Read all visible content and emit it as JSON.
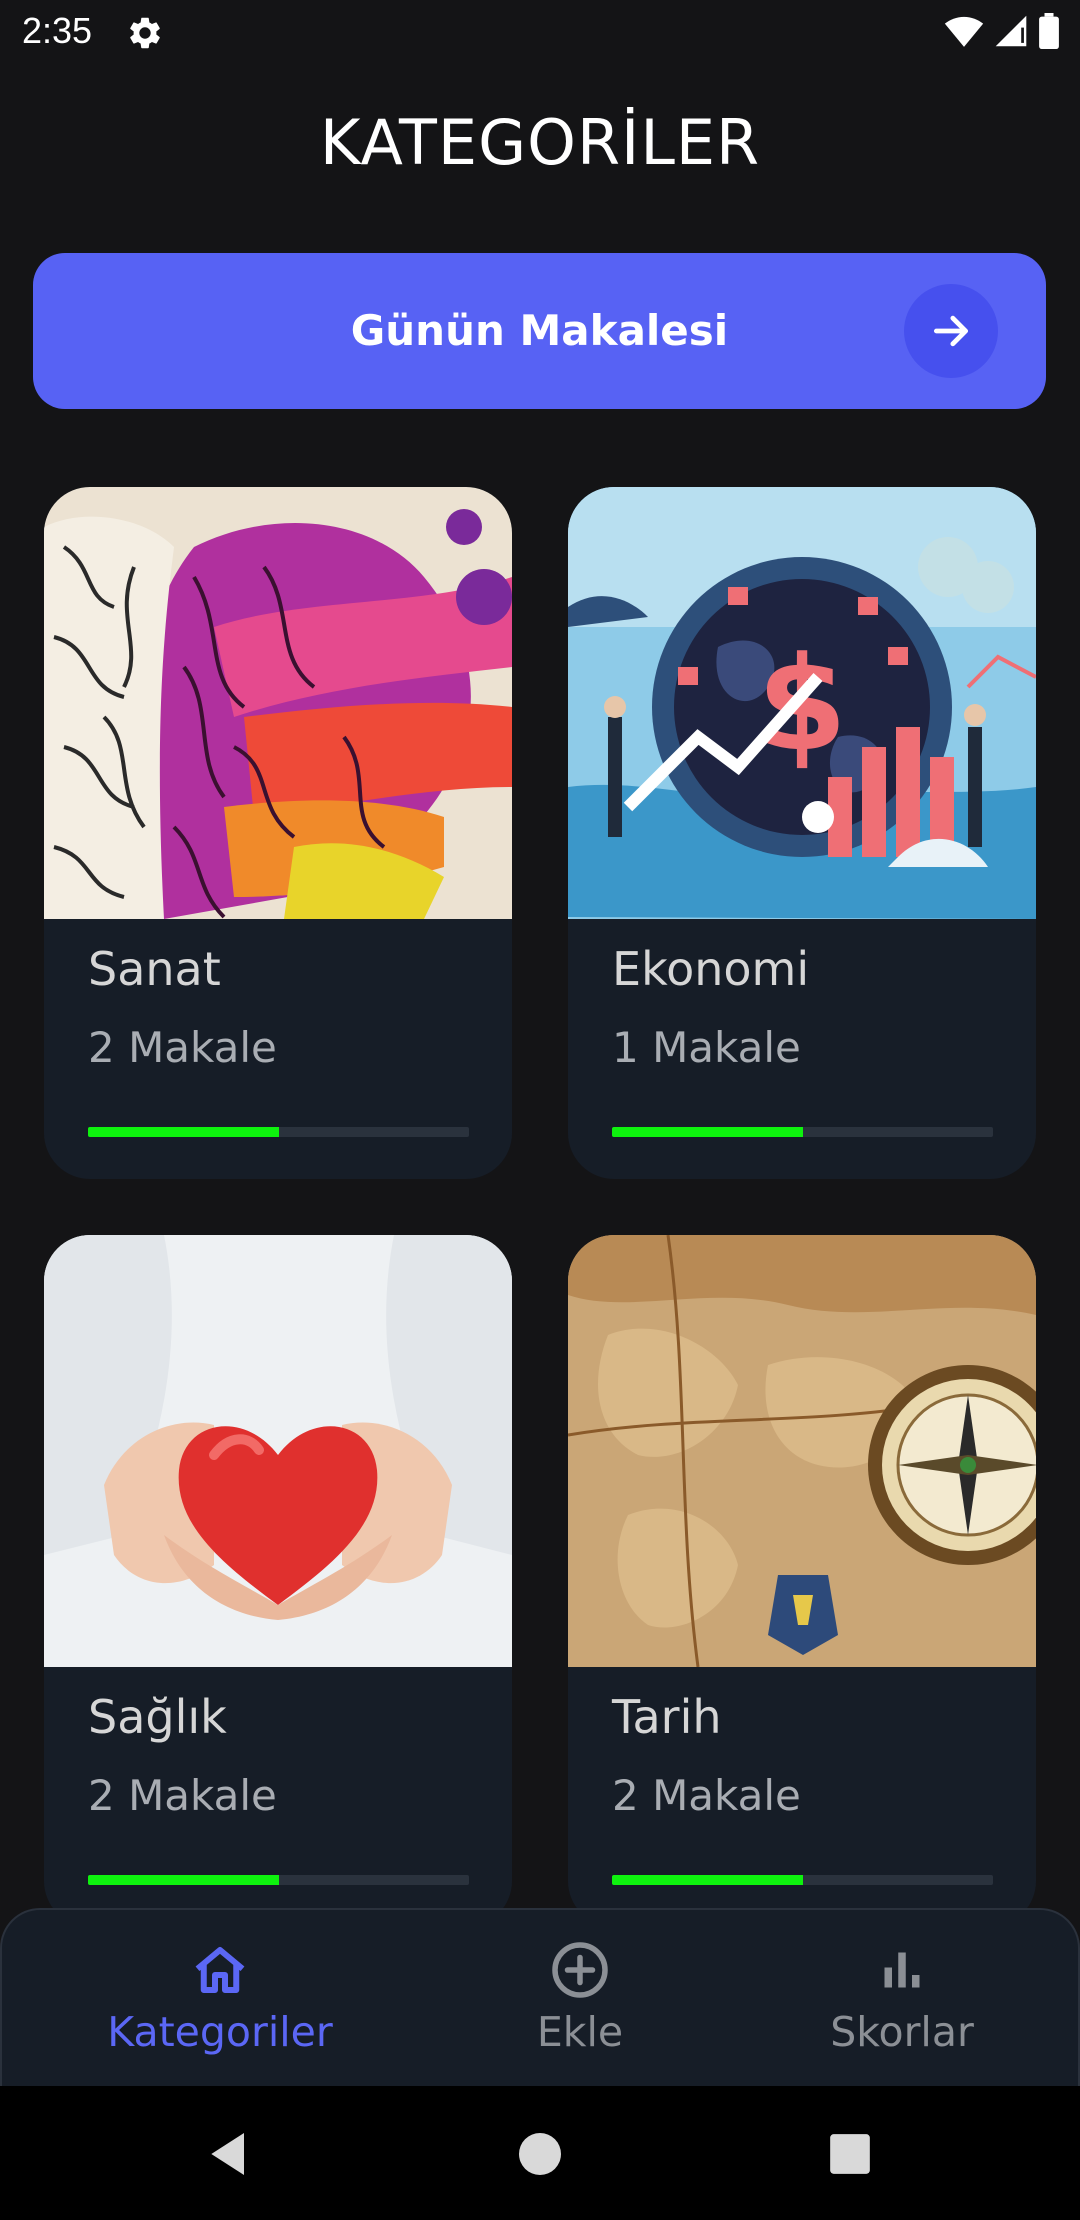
{
  "status_bar": {
    "time": "2:35",
    "icons": [
      "gear-icon",
      "wifi-icon",
      "cell-signal-icon",
      "battery-icon"
    ]
  },
  "page": {
    "title": "KATEGORİLER"
  },
  "banner": {
    "label": "Günün Makalesi",
    "icon": "arrow-right-icon",
    "color": "#5762f4"
  },
  "categories": [
    {
      "title": "Sanat",
      "count": "2 Makale",
      "progress": 0.5,
      "image": "brain-art-illustration"
    },
    {
      "title": "Ekonomi",
      "count": "1 Makale",
      "progress": 0.5,
      "image": "economy-globe-illustration"
    },
    {
      "title": "Sağlık",
      "count": "2 Makale",
      "progress": 0.5,
      "image": "hands-holding-heart-photo"
    },
    {
      "title": "Tarih",
      "count": "2 Makale",
      "progress": 0.5,
      "image": "old-map-compass-photo"
    }
  ],
  "bottom_nav": {
    "items": [
      {
        "label": "Kategoriler",
        "icon": "home-icon",
        "active": true
      },
      {
        "label": "Ekle",
        "icon": "add-circle-icon",
        "active": false
      },
      {
        "label": "Skorlar",
        "icon": "bar-chart-icon",
        "active": false
      }
    ],
    "active_color": "#5b67f5",
    "inactive_color": "#8b8f95"
  },
  "system_nav": {
    "buttons": [
      "back-icon",
      "home-circle-icon",
      "recents-icon"
    ]
  }
}
